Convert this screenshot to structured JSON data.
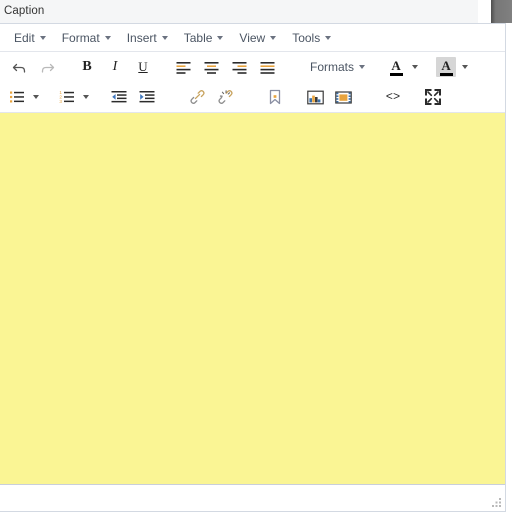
{
  "window": {
    "caption_label": "Caption",
    "corner_widget": "scroll-corner"
  },
  "menubar": {
    "items": [
      {
        "label": "Edit",
        "name": "menu-edit"
      },
      {
        "label": "Format",
        "name": "menu-format"
      },
      {
        "label": "Insert",
        "name": "menu-insert"
      },
      {
        "label": "Table",
        "name": "menu-table"
      },
      {
        "label": "View",
        "name": "menu-view"
      },
      {
        "label": "Tools",
        "name": "menu-tools"
      }
    ]
  },
  "toolbar_row1": {
    "undo": "undo-icon",
    "redo": "redo-icon",
    "bold": "B",
    "italic": "I",
    "underline": "U",
    "align_left": "align-left-icon",
    "align_center": "align-center-icon",
    "align_right": "align-right-icon",
    "align_justify": "align-justify-icon",
    "formats_label": "Formats",
    "text_color": "text-color-icon",
    "text_color_value": "#000000",
    "background_color": "background-color-icon",
    "background_color_value": "#ffff00"
  },
  "toolbar_row2": {
    "bullet_list": "bullet-list-icon",
    "numbered_list": "numbered-list-icon",
    "outdent": "outdent-icon",
    "indent": "indent-icon",
    "link": "link-icon",
    "unlink": "unlink-icon",
    "anchor": "anchor-icon",
    "image": "image-icon",
    "media": "media-icon",
    "source_code": "<>",
    "fullscreen": "fullscreen-icon"
  },
  "editor": {
    "content": "",
    "background_color": "#faf594"
  },
  "statusbar": {
    "element_path": "",
    "resize_handle": "resize-grip-icon"
  },
  "colors": {
    "yellow_highlight": "#faf594",
    "menu_text": "#4b5563",
    "frame_border": "#d3d9e2",
    "caption_bg": "#f5f6f7"
  }
}
